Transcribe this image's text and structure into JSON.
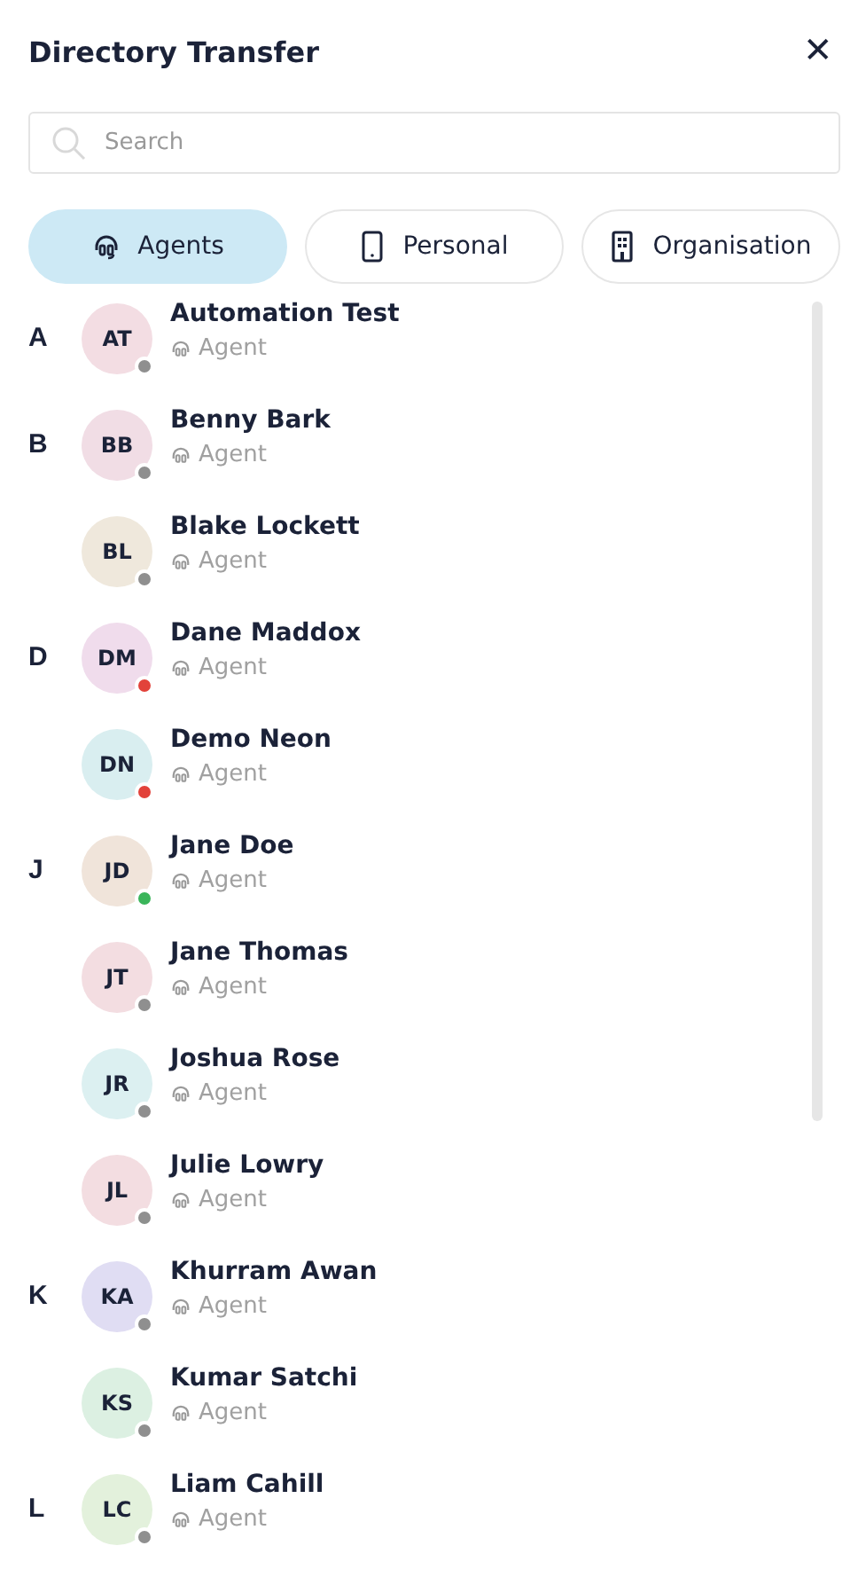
{
  "header": {
    "title": "Directory Transfer",
    "close": "✕"
  },
  "search": {
    "placeholder": "Search"
  },
  "tabs": [
    {
      "label": "Agents",
      "selected": true
    },
    {
      "label": "Personal",
      "selected": false
    },
    {
      "label": "Organisation",
      "selected": false
    }
  ],
  "contacts": [
    {
      "letter": "A",
      "initials": "AT",
      "name": "Automation Test",
      "role": "Agent",
      "color": "#8f8f8f"
    },
    {
      "letter": "B",
      "initials": "BB",
      "name": "Benny Bark",
      "role": "Agent",
      "color": "#8f8f8f"
    },
    {
      "initials": "BL",
      "name": "Blake Lockett",
      "role": "Agent",
      "color": "#8f8f8f"
    },
    {
      "letter": "D",
      "initials": "DM",
      "name": "Dane Maddox",
      "role": "Agent",
      "color": "#e2423a"
    },
    {
      "initials": "DN",
      "name": "Demo Neon",
      "role": "Agent",
      "color": "#e2423a"
    },
    {
      "letter": "J",
      "initials": "JD",
      "name": "Jane Doe",
      "role": "Agent",
      "color": "#3ab55a"
    },
    {
      "initials": "JT",
      "name": "Jane Thomas",
      "role": "Agent",
      "color": "#8f8f8f"
    },
    {
      "initials": "JR",
      "name": "Joshua Rose",
      "role": "Agent",
      "color": "#8f8f8f"
    },
    {
      "initials": "JL",
      "name": "Julie Lowry",
      "role": "Agent",
      "color": "#8f8f8f"
    },
    {
      "letter": "K",
      "initials": "KA",
      "name": "Khurram Awan",
      "role": "Agent",
      "color": "#8f8f8f"
    },
    {
      "initials": "KS",
      "name": "Kumar Satchi",
      "role": "Agent",
      "color": "#8f8f8f"
    },
    {
      "letter": "L",
      "initials": "LC",
      "name": "Liam Cahill",
      "role": "Agent",
      "color": "#8f8f8f"
    }
  ]
}
